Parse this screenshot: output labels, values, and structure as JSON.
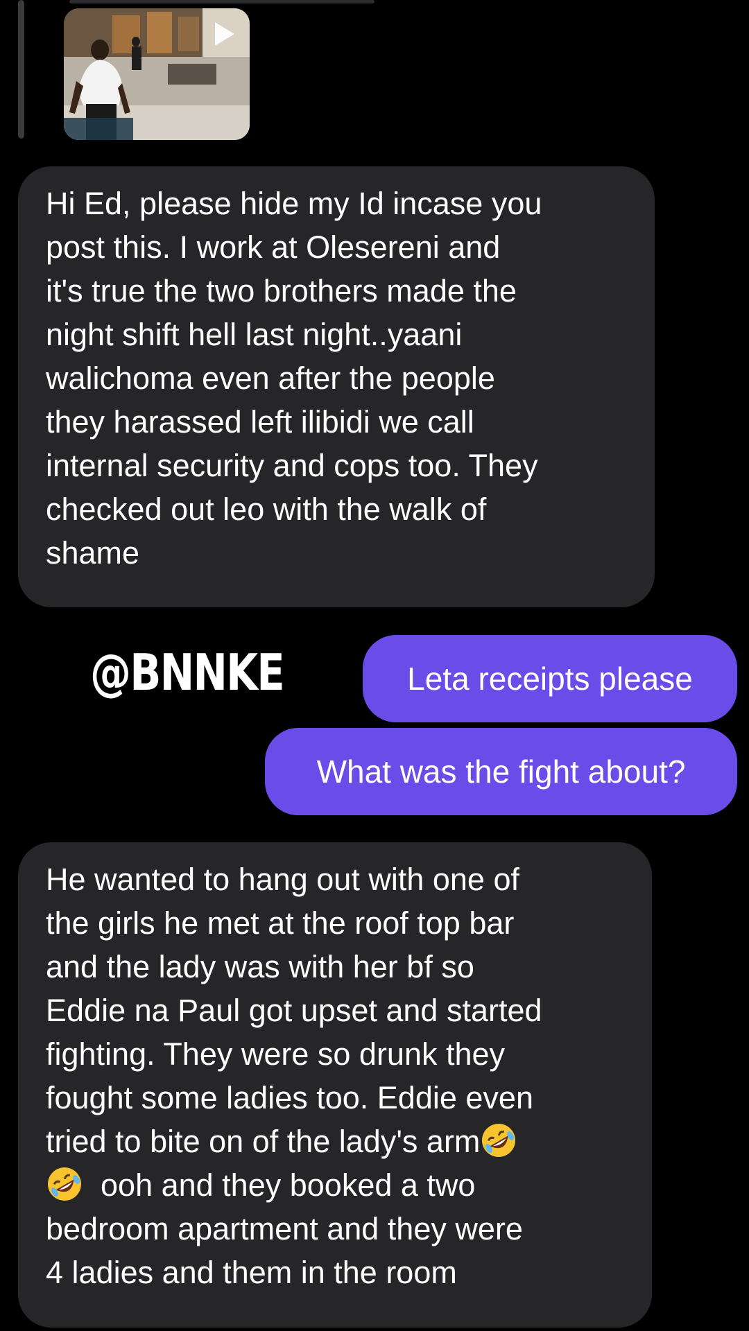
{
  "thread": {
    "video_attachment": {
      "icon": "play-icon"
    },
    "messages": [
      {
        "direction": "incoming",
        "lines": [
          "Hi Ed, please hide my Id incase you",
          "post this. I work at Olesereni and",
          "it's true the two brothers made the",
          "night shift hell last night..yaani",
          "walichoma even after the people",
          "they harassed left ilibidi we call",
          "internal security and cops too. They",
          "checked out leo with the walk of",
          "shame"
        ]
      },
      {
        "direction": "outgoing",
        "text": "Leta receipts please"
      },
      {
        "direction": "outgoing",
        "text": "What was the fight about?"
      },
      {
        "direction": "incoming",
        "lines": [
          "He wanted to hang out with one of",
          "the girls he met at the roof top bar",
          "and the lady was with her bf so",
          "Eddie na Paul got upset and started",
          "fighting. They were so drunk they",
          "fought some ladies too. Eddie even",
          "tried to bite on of the lady's arm",
          "ooh and they booked a two",
          "bedroom apartment and they were",
          "4 ladies and them in the room"
        ],
        "emoji": "rolling-on-floor-laughing-emoji"
      }
    ]
  },
  "watermark": "@BNNKE",
  "colors": {
    "background": "#000000",
    "incoming_bubble": "#262628",
    "outgoing_bubble": "#6a4de8",
    "text": "#ffffff"
  }
}
